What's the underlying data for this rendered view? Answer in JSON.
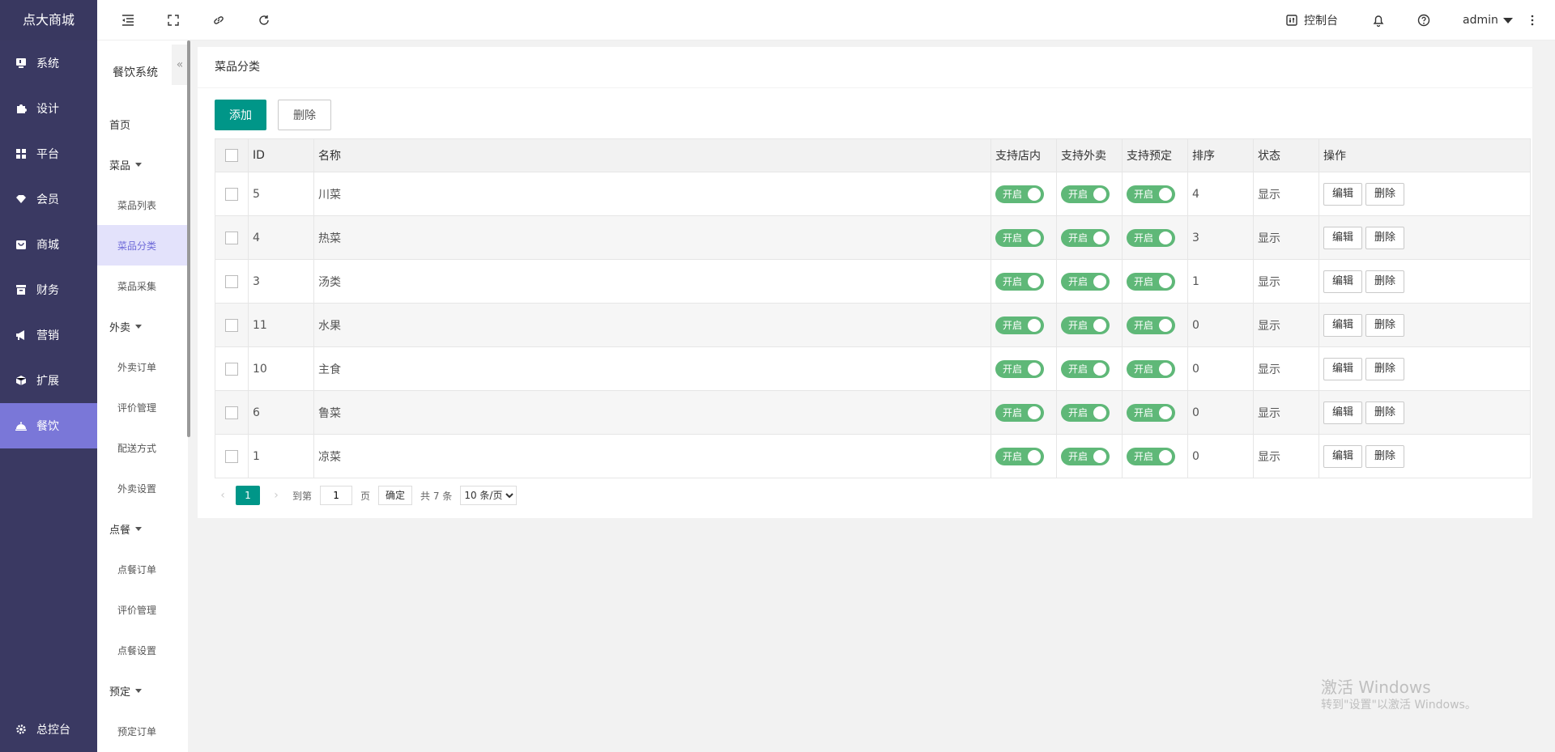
{
  "brand": "点大商城",
  "main_nav": [
    {
      "label": "系统",
      "icon": "monitor-icon"
    },
    {
      "label": "设计",
      "icon": "puzzle-icon"
    },
    {
      "label": "平台",
      "icon": "grid-icon"
    },
    {
      "label": "会员",
      "icon": "diamond-icon"
    },
    {
      "label": "商城",
      "icon": "shop-icon"
    },
    {
      "label": "财务",
      "icon": "wallet-icon"
    },
    {
      "label": "营销",
      "icon": "megaphone-icon"
    },
    {
      "label": "扩展",
      "icon": "cube-icon"
    },
    {
      "label": "餐饮",
      "icon": "cloche-icon"
    }
  ],
  "main_nav_active": "餐饮",
  "nav_bottom": {
    "label": "总控台",
    "icon": "gear-icon"
  },
  "sub_nav": {
    "title": "餐饮系统",
    "collapse_glyph": "«",
    "items": [
      {
        "label": "首页",
        "level": 1
      },
      {
        "label": "菜品",
        "level": 1,
        "expanded": true
      },
      {
        "label": "菜品列表",
        "level": 2
      },
      {
        "label": "菜品分类",
        "level": 2,
        "active": true
      },
      {
        "label": "菜品采集",
        "level": 2
      },
      {
        "label": "外卖",
        "level": 1,
        "expanded": true
      },
      {
        "label": "外卖订单",
        "level": 2
      },
      {
        "label": "评价管理",
        "level": 2
      },
      {
        "label": "配送方式",
        "level": 2
      },
      {
        "label": "外卖设置",
        "level": 2
      },
      {
        "label": "点餐",
        "level": 1,
        "expanded": true
      },
      {
        "label": "点餐订单",
        "level": 2
      },
      {
        "label": "评价管理",
        "level": 2
      },
      {
        "label": "点餐设置",
        "level": 2
      },
      {
        "label": "预定",
        "level": 1,
        "expanded": true
      },
      {
        "label": "预定订单",
        "level": 2
      }
    ]
  },
  "topbar": {
    "console_label": "控制台",
    "user_label": "admin"
  },
  "card": {
    "title": "菜品分类",
    "add_label": "添加",
    "delete_label": "删除"
  },
  "table": {
    "headers": [
      "ID",
      "名称",
      "支持店内",
      "支持外卖",
      "支持预定",
      "排序",
      "状态",
      "操作"
    ],
    "switch_label": "开启",
    "edit_label": "编辑",
    "delete_label": "删除",
    "rows": [
      {
        "id": "5",
        "name": "川菜",
        "sort": "4",
        "status": "显示"
      },
      {
        "id": "4",
        "name": "热菜",
        "sort": "3",
        "status": "显示"
      },
      {
        "id": "3",
        "name": "汤类",
        "sort": "1",
        "status": "显示"
      },
      {
        "id": "11",
        "name": "水果",
        "sort": "0",
        "status": "显示"
      },
      {
        "id": "10",
        "name": "主食",
        "sort": "0",
        "status": "显示"
      },
      {
        "id": "6",
        "name": "鲁菜",
        "sort": "0",
        "status": "显示"
      },
      {
        "id": "1",
        "name": "凉菜",
        "sort": "0",
        "status": "显示"
      }
    ]
  },
  "pager": {
    "current": "1",
    "goto_label": "到第",
    "goto_value": "1",
    "page_label": "页",
    "ok_label": "确定",
    "total_label": "共 7 条",
    "page_size": "10 条/页"
  },
  "watermark": {
    "line1": "激活 Windows",
    "line2": "转到\"设置\"以激活 Windows。"
  },
  "colors": {
    "sidebar": "#3a3962",
    "sidebar_active": "#7a77d8",
    "primary": "#009688",
    "switch_on": "#5fb878",
    "status_show": "#1e9e34"
  }
}
